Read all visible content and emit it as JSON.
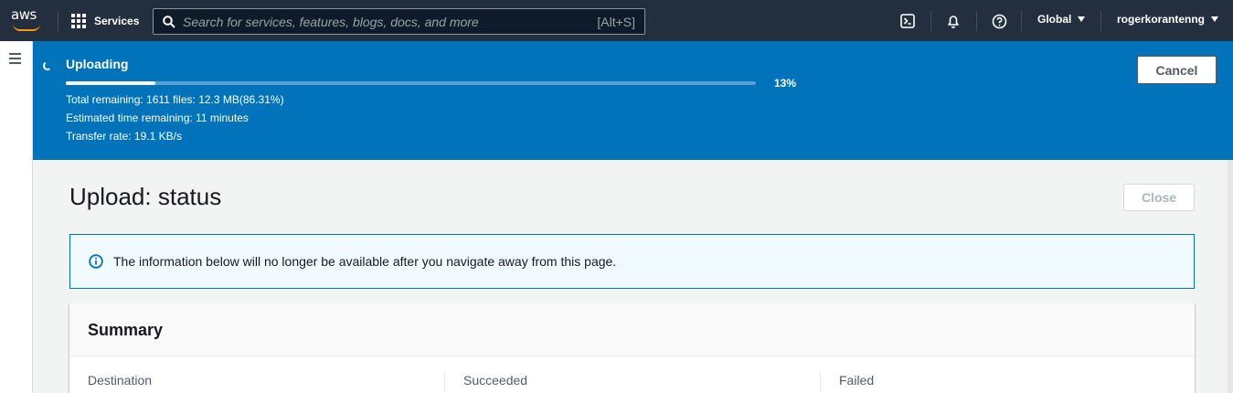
{
  "nav": {
    "logo_text": "aws",
    "services_label": "Services",
    "search_placeholder": "Search for services, features, blogs, docs, and more",
    "search_shortcut": "[Alt+S]",
    "region_label": "Global",
    "account_label": "rogerkorantenng"
  },
  "flash": {
    "title": "Uploading",
    "progress_fraction": 0.13,
    "progress_label": "13%",
    "remaining": "Total remaining: 1611 files: 12.3 MB(86.31%)",
    "eta": "Estimated time remaining: 11 minutes",
    "rate": "Transfer rate: 19.1 KB/s",
    "cancel_label": "Cancel",
    "bg_color": "#0073bb"
  },
  "page": {
    "title": "Upload: status",
    "close_label": "Close",
    "info_message": "The information below will no longer be available after you navigate away from this page."
  },
  "summary": {
    "title": "Summary",
    "columns": [
      "Destination",
      "Succeeded",
      "Failed"
    ]
  },
  "icons": [
    "aws-logo-icon",
    "grid-icon",
    "search-icon",
    "cloudshell-icon",
    "bell-icon",
    "help-icon",
    "hamburger-icon",
    "spinner-icon",
    "info-icon"
  ]
}
